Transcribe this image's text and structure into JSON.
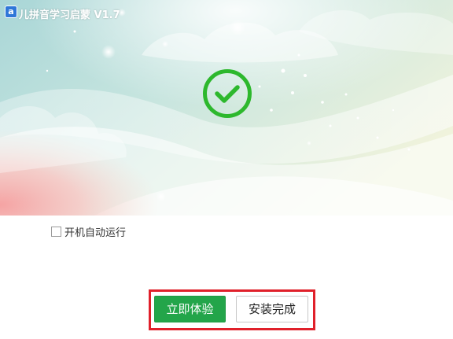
{
  "window": {
    "title": "儿拼音学习启蒙 V1.7",
    "logo_glyph": "a"
  },
  "status": {
    "icon": "checkmark-circle-icon",
    "color": "#2db82d"
  },
  "options": {
    "autorun_label": "开机自动运行",
    "autorun_checked": false
  },
  "actions": {
    "primary_label": "立即体验",
    "secondary_label": "安装完成"
  },
  "colors": {
    "primary_button": "#23a54a",
    "highlight_border": "#e0202a"
  }
}
